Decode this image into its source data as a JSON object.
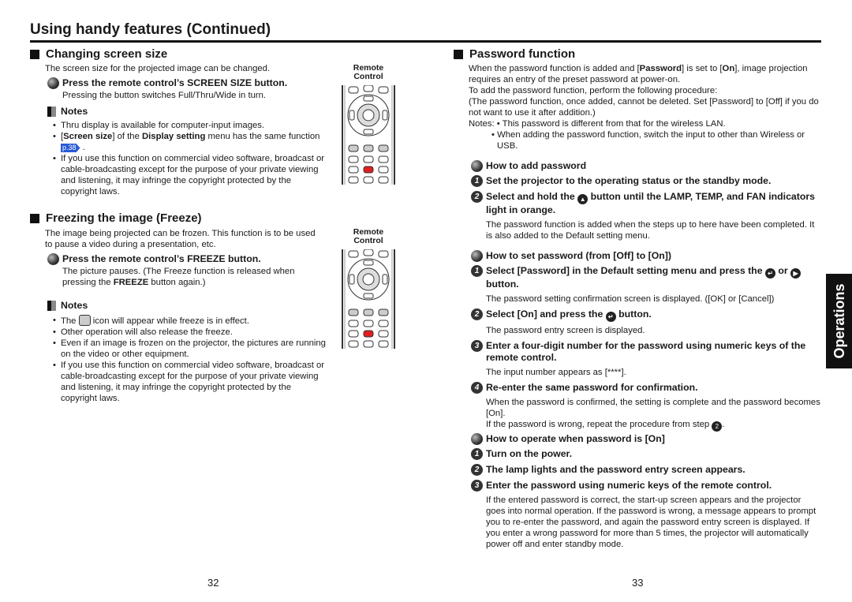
{
  "header": {
    "title": "Using handy features (Continued)"
  },
  "left": {
    "screen_size": {
      "heading": "Changing screen size",
      "intro": "The screen size for the projected image can be changed.",
      "step": "Press the remote control’s SCREEN SIZE button.",
      "step_detail": "Pressing the button switches Full/Thru/Wide in turn.",
      "notes_label": "Notes",
      "notes": [
        [
          {
            "t": "Thru display is available for computer-input images."
          }
        ],
        [
          {
            "t": "["
          },
          {
            "t": "Screen size",
            "b": true
          },
          {
            "t": "] of the "
          },
          {
            "t": "Display setting",
            "b": true
          },
          {
            "t": " menu has the same function "
          },
          {
            "ref": "p.38"
          },
          {
            "t": " ."
          }
        ],
        [
          {
            "t": "If you use this function on commercial video software, broadcast or cable-broadcasting except for the purpose of your private viewing and listening, it may infringe the copyright protected by the copyright laws."
          }
        ]
      ],
      "remote_label": "Remote Control"
    },
    "freeze": {
      "heading": "Freezing the image (Freeze)",
      "intro": "The image being projected can be frozen. This function is to be used to pause a video during a presentation, etc.",
      "step": "Press the remote control’s FREEZE button.",
      "step_detail": [
        {
          "t": "The picture pauses. (The Freeze function is released when pressing the "
        },
        {
          "t": "FREEZE",
          "b": true
        },
        {
          "t": " button again.)"
        }
      ],
      "notes_label": "Notes",
      "notes": [
        [
          {
            "t": "The "
          },
          {
            "icon": "freeze"
          },
          {
            "t": " icon will appear while freeze is in effect."
          }
        ],
        [
          {
            "t": "Other operation will also release the freeze."
          }
        ],
        [
          {
            "t": "Even if an image is frozen on the projector, the pictures are running on the video or other equipment."
          }
        ],
        [
          {
            "t": "If you use this function on commercial video software, broadcast or cable-broadcasting except for the purpose of your private viewing and listening, it may infringe the copyright protected by the copyright laws."
          }
        ]
      ],
      "remote_label": "Remote Control"
    },
    "page_number": "32"
  },
  "right": {
    "heading": "Password function",
    "intro": [
      [
        {
          "t": "When the password function is added and ["
        },
        {
          "t": "Password",
          "b": true
        },
        {
          "t": "] is set to ["
        },
        {
          "t": "On",
          "b": true
        },
        {
          "t": "], image projection requires an entry of the preset password at power-on."
        }
      ],
      [
        {
          "t": "To add the password function, perform the following procedure:"
        }
      ],
      [
        {
          "t": "(The password function, once added, cannot be deleted. Set [Password] to [Off] if you do not want to use it after addition.)"
        }
      ],
      [
        {
          "t": "Notes: • This password is different from that for the wireless LAN."
        }
      ]
    ],
    "intro_note2": "• When adding the password function, switch the input to other than Wireless or USB.",
    "add": {
      "title": "How to add password",
      "steps": [
        {
          "n": "1",
          "text": [
            {
              "t": "Set the projector to the operating status or the standby mode."
            }
          ]
        },
        {
          "n": "2",
          "text": [
            {
              "t": "Select and hold the "
            },
            {
              "icon": "up",
              "g": "▲"
            },
            {
              "t": " button until the LAMP, TEMP, and FAN indicators light in orange."
            }
          ],
          "detail": "The password function is added when the steps up to here have been completed. It is also added to the Default setting menu."
        }
      ]
    },
    "set": {
      "title": "How to set password (from [Off] to [On])",
      "steps": [
        {
          "n": "1",
          "text": [
            {
              "t": "Select [Password] in the Default setting menu and press the "
            },
            {
              "icon": "enter",
              "g": "↵"
            },
            {
              "t": " or "
            },
            {
              "icon": "right",
              "g": "▶"
            },
            {
              "t": " button."
            }
          ],
          "detail": "The password setting confirmation screen is displayed. ([OK] or [Cancel])"
        },
        {
          "n": "2",
          "text": [
            {
              "t": "Select [On] and press the "
            },
            {
              "icon": "enter",
              "g": "↵"
            },
            {
              "t": " button."
            }
          ],
          "detail": "The password entry screen is displayed."
        },
        {
          "n": "3",
          "text": [
            {
              "t": "Enter a four-digit number for the password using numeric keys of the remote control."
            }
          ],
          "detail": "The input number appears as [****]."
        },
        {
          "n": "4",
          "text": [
            {
              "t": "Re-enter the same password for confirmation."
            }
          ],
          "detail": "When the password is confirmed, the setting is complete and the password becomes [On].",
          "detail2": [
            {
              "t": "If the password is wrong, repeat the procedure from step "
            },
            {
              "icon": "step2",
              "g": "2"
            },
            {
              "t": "."
            }
          ]
        }
      ]
    },
    "operate": {
      "title": "How to operate when password is [On]",
      "steps": [
        {
          "n": "1",
          "text": [
            {
              "t": "Turn on the power."
            }
          ]
        },
        {
          "n": "2",
          "text": [
            {
              "t": "The lamp lights and the password entry screen appears."
            }
          ]
        },
        {
          "n": "3",
          "text": [
            {
              "t": "Enter the password using numeric keys of the remote control."
            }
          ],
          "detail": "If the entered password is correct, the start-up screen appears and the projector goes into normal operation. If the password is wrong, a message appears to prompt you to re-enter the password, and again the password entry screen is displayed. If you enter a wrong password for more than 5 times, the projector will automatically power off and enter standby mode."
        }
      ]
    },
    "page_number": "33",
    "side_tab": "Operations"
  },
  "colors": {
    "text": "#1a1a1a",
    "page_ref": "#2a5bd7",
    "remote_highlight": "#e02020",
    "tab": "#111111"
  }
}
